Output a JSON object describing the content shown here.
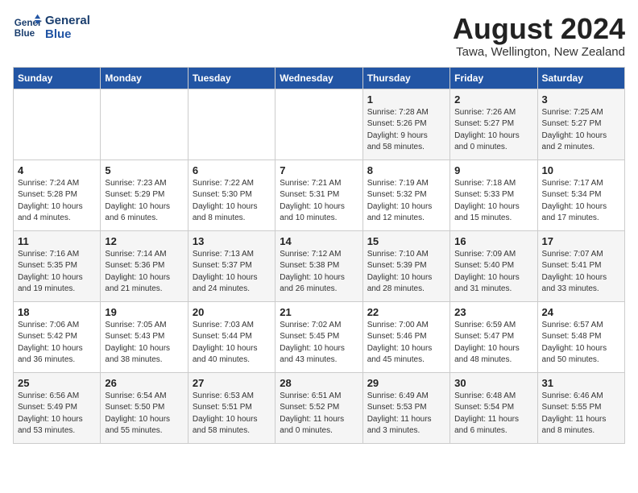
{
  "header": {
    "logo_line1": "General",
    "logo_line2": "Blue",
    "month_year": "August 2024",
    "location": "Tawa, Wellington, New Zealand"
  },
  "weekdays": [
    "Sunday",
    "Monday",
    "Tuesday",
    "Wednesday",
    "Thursday",
    "Friday",
    "Saturday"
  ],
  "weeks": [
    [
      {
        "day": "",
        "info": ""
      },
      {
        "day": "",
        "info": ""
      },
      {
        "day": "",
        "info": ""
      },
      {
        "day": "",
        "info": ""
      },
      {
        "day": "1",
        "info": "Sunrise: 7:28 AM\nSunset: 5:26 PM\nDaylight: 9 hours\nand 58 minutes."
      },
      {
        "day": "2",
        "info": "Sunrise: 7:26 AM\nSunset: 5:27 PM\nDaylight: 10 hours\nand 0 minutes."
      },
      {
        "day": "3",
        "info": "Sunrise: 7:25 AM\nSunset: 5:27 PM\nDaylight: 10 hours\nand 2 minutes."
      }
    ],
    [
      {
        "day": "4",
        "info": "Sunrise: 7:24 AM\nSunset: 5:28 PM\nDaylight: 10 hours\nand 4 minutes."
      },
      {
        "day": "5",
        "info": "Sunrise: 7:23 AM\nSunset: 5:29 PM\nDaylight: 10 hours\nand 6 minutes."
      },
      {
        "day": "6",
        "info": "Sunrise: 7:22 AM\nSunset: 5:30 PM\nDaylight: 10 hours\nand 8 minutes."
      },
      {
        "day": "7",
        "info": "Sunrise: 7:21 AM\nSunset: 5:31 PM\nDaylight: 10 hours\nand 10 minutes."
      },
      {
        "day": "8",
        "info": "Sunrise: 7:19 AM\nSunset: 5:32 PM\nDaylight: 10 hours\nand 12 minutes."
      },
      {
        "day": "9",
        "info": "Sunrise: 7:18 AM\nSunset: 5:33 PM\nDaylight: 10 hours\nand 15 minutes."
      },
      {
        "day": "10",
        "info": "Sunrise: 7:17 AM\nSunset: 5:34 PM\nDaylight: 10 hours\nand 17 minutes."
      }
    ],
    [
      {
        "day": "11",
        "info": "Sunrise: 7:16 AM\nSunset: 5:35 PM\nDaylight: 10 hours\nand 19 minutes."
      },
      {
        "day": "12",
        "info": "Sunrise: 7:14 AM\nSunset: 5:36 PM\nDaylight: 10 hours\nand 21 minutes."
      },
      {
        "day": "13",
        "info": "Sunrise: 7:13 AM\nSunset: 5:37 PM\nDaylight: 10 hours\nand 24 minutes."
      },
      {
        "day": "14",
        "info": "Sunrise: 7:12 AM\nSunset: 5:38 PM\nDaylight: 10 hours\nand 26 minutes."
      },
      {
        "day": "15",
        "info": "Sunrise: 7:10 AM\nSunset: 5:39 PM\nDaylight: 10 hours\nand 28 minutes."
      },
      {
        "day": "16",
        "info": "Sunrise: 7:09 AM\nSunset: 5:40 PM\nDaylight: 10 hours\nand 31 minutes."
      },
      {
        "day": "17",
        "info": "Sunrise: 7:07 AM\nSunset: 5:41 PM\nDaylight: 10 hours\nand 33 minutes."
      }
    ],
    [
      {
        "day": "18",
        "info": "Sunrise: 7:06 AM\nSunset: 5:42 PM\nDaylight: 10 hours\nand 36 minutes."
      },
      {
        "day": "19",
        "info": "Sunrise: 7:05 AM\nSunset: 5:43 PM\nDaylight: 10 hours\nand 38 minutes."
      },
      {
        "day": "20",
        "info": "Sunrise: 7:03 AM\nSunset: 5:44 PM\nDaylight: 10 hours\nand 40 minutes."
      },
      {
        "day": "21",
        "info": "Sunrise: 7:02 AM\nSunset: 5:45 PM\nDaylight: 10 hours\nand 43 minutes."
      },
      {
        "day": "22",
        "info": "Sunrise: 7:00 AM\nSunset: 5:46 PM\nDaylight: 10 hours\nand 45 minutes."
      },
      {
        "day": "23",
        "info": "Sunrise: 6:59 AM\nSunset: 5:47 PM\nDaylight: 10 hours\nand 48 minutes."
      },
      {
        "day": "24",
        "info": "Sunrise: 6:57 AM\nSunset: 5:48 PM\nDaylight: 10 hours\nand 50 minutes."
      }
    ],
    [
      {
        "day": "25",
        "info": "Sunrise: 6:56 AM\nSunset: 5:49 PM\nDaylight: 10 hours\nand 53 minutes."
      },
      {
        "day": "26",
        "info": "Sunrise: 6:54 AM\nSunset: 5:50 PM\nDaylight: 10 hours\nand 55 minutes."
      },
      {
        "day": "27",
        "info": "Sunrise: 6:53 AM\nSunset: 5:51 PM\nDaylight: 10 hours\nand 58 minutes."
      },
      {
        "day": "28",
        "info": "Sunrise: 6:51 AM\nSunset: 5:52 PM\nDaylight: 11 hours\nand 0 minutes."
      },
      {
        "day": "29",
        "info": "Sunrise: 6:49 AM\nSunset: 5:53 PM\nDaylight: 11 hours\nand 3 minutes."
      },
      {
        "day": "30",
        "info": "Sunrise: 6:48 AM\nSunset: 5:54 PM\nDaylight: 11 hours\nand 6 minutes."
      },
      {
        "day": "31",
        "info": "Sunrise: 6:46 AM\nSunset: 5:55 PM\nDaylight: 11 hours\nand 8 minutes."
      }
    ]
  ]
}
